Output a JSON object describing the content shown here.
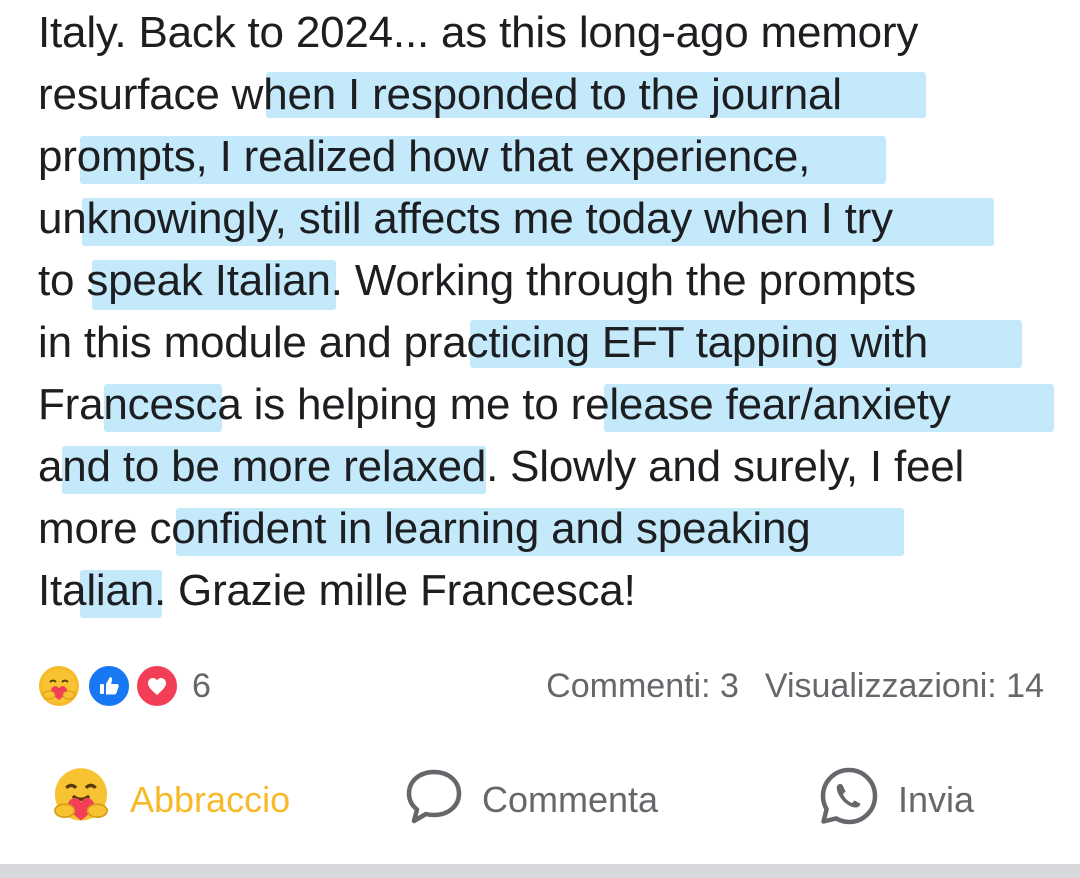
{
  "post": {
    "lines": [
      "Italy.  Back to 2024... as this long-ago memory",
      "resurface when I responded to the journal",
      "prompts, I realized how that experience,",
      "unknowingly, still affects me today when I try",
      "to speak Italian.  Working through the prompts",
      "in this module and practicing EFT tapping with",
      "Francesca is helping me to release fear/anxiety",
      "and to be more relaxed. Slowly and surely, I feel",
      "more confident in learning and speaking",
      "Italian. Grazie mille Francesca!"
    ]
  },
  "reactions": {
    "icons": [
      "care-icon",
      "like-icon",
      "love-icon"
    ],
    "count": "6"
  },
  "stats": {
    "comments": "Commenti: 3",
    "views": "Visualizzazioni: 14"
  },
  "actions": {
    "hug_label": "Abbraccio",
    "comment_label": "Commenta",
    "send_label": "Invia"
  },
  "colors": {
    "highlight": "#ace0f8",
    "hug_active": "#f7b928",
    "muted_text": "#65676b",
    "like_blue": "#1877f2",
    "love_red": "#f33e58"
  }
}
